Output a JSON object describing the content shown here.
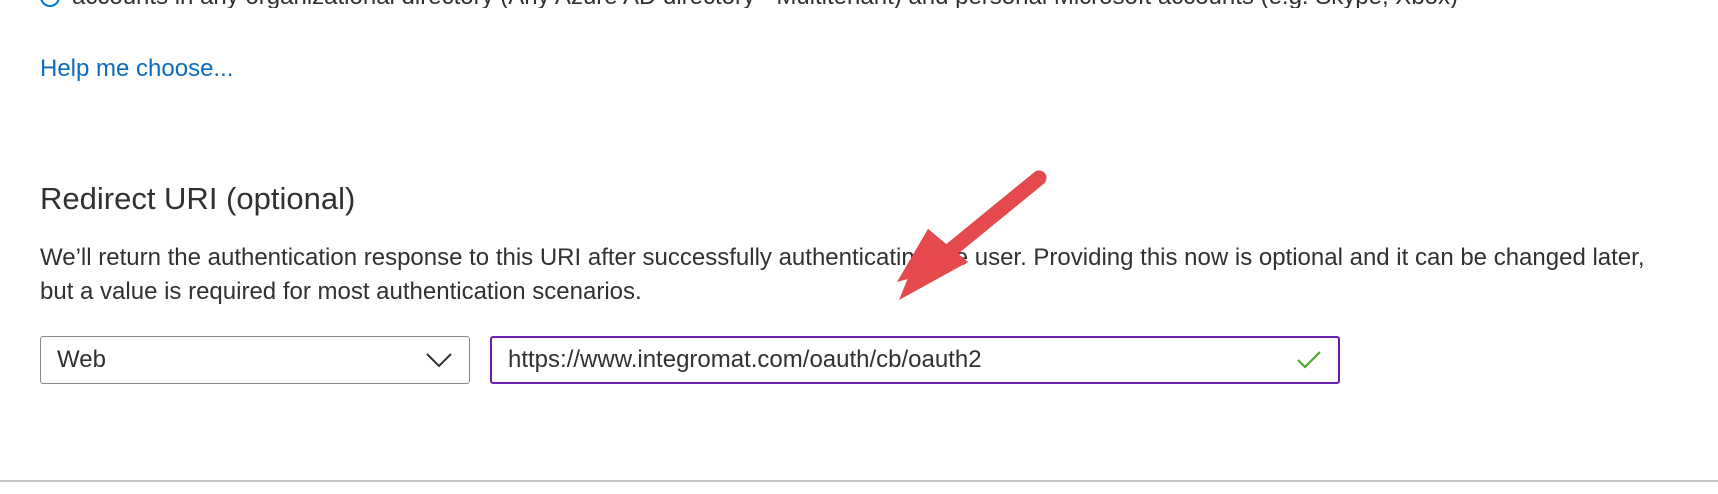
{
  "top": {
    "cut_text": "accounts in any organizational directory (Any Azure AD directory - Multitenant) and personal Microsoft accounts (e.g. Skype, Xbox)",
    "info_icon": "info-icon"
  },
  "help_link": {
    "label": "Help me choose..."
  },
  "redirect": {
    "title": "Redirect URI (optional)",
    "description": "We’ll return the authentication response to this URI after successfully authenticating the user. Providing this now is optional and it can be changed later, but a value is required for most authentication scenarios.",
    "platform": {
      "selected": "Web",
      "icon": "chevron-down-icon"
    },
    "uri": {
      "value": "https://www.integromat.com/oauth/cb/oauth2",
      "valid_icon": "checkmark-icon"
    }
  },
  "annotation": {
    "icon": "red-arrow-icon",
    "color": "#e5484d"
  },
  "colors": {
    "link": "#0f6cbd",
    "focus_border": "#6b1fae",
    "check": "#4ea72e"
  }
}
